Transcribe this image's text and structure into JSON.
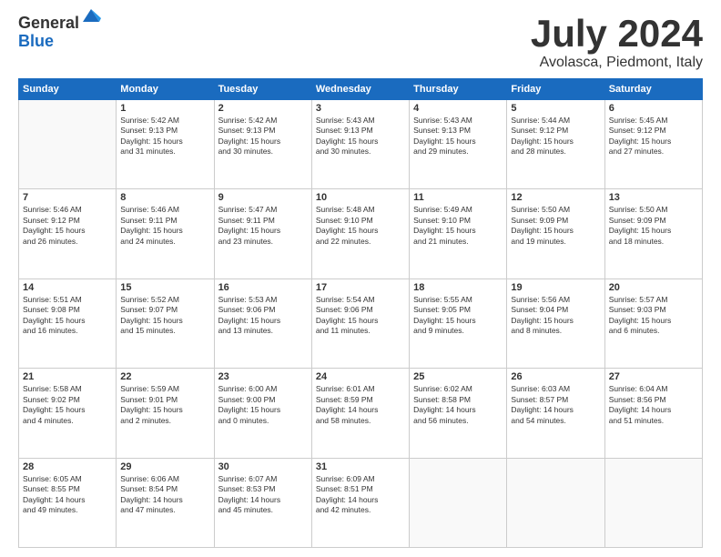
{
  "logo": {
    "general": "General",
    "blue": "Blue"
  },
  "title": "July 2024",
  "location": "Avolasca, Piedmont, Italy",
  "weekdays": [
    "Sunday",
    "Monday",
    "Tuesday",
    "Wednesday",
    "Thursday",
    "Friday",
    "Saturday"
  ],
  "weeks": [
    [
      {
        "day": "",
        "info": ""
      },
      {
        "day": "1",
        "info": "Sunrise: 5:42 AM\nSunset: 9:13 PM\nDaylight: 15 hours\nand 31 minutes."
      },
      {
        "day": "2",
        "info": "Sunrise: 5:42 AM\nSunset: 9:13 PM\nDaylight: 15 hours\nand 30 minutes."
      },
      {
        "day": "3",
        "info": "Sunrise: 5:43 AM\nSunset: 9:13 PM\nDaylight: 15 hours\nand 30 minutes."
      },
      {
        "day": "4",
        "info": "Sunrise: 5:43 AM\nSunset: 9:13 PM\nDaylight: 15 hours\nand 29 minutes."
      },
      {
        "day": "5",
        "info": "Sunrise: 5:44 AM\nSunset: 9:12 PM\nDaylight: 15 hours\nand 28 minutes."
      },
      {
        "day": "6",
        "info": "Sunrise: 5:45 AM\nSunset: 9:12 PM\nDaylight: 15 hours\nand 27 minutes."
      }
    ],
    [
      {
        "day": "7",
        "info": "Sunrise: 5:46 AM\nSunset: 9:12 PM\nDaylight: 15 hours\nand 26 minutes."
      },
      {
        "day": "8",
        "info": "Sunrise: 5:46 AM\nSunset: 9:11 PM\nDaylight: 15 hours\nand 24 minutes."
      },
      {
        "day": "9",
        "info": "Sunrise: 5:47 AM\nSunset: 9:11 PM\nDaylight: 15 hours\nand 23 minutes."
      },
      {
        "day": "10",
        "info": "Sunrise: 5:48 AM\nSunset: 9:10 PM\nDaylight: 15 hours\nand 22 minutes."
      },
      {
        "day": "11",
        "info": "Sunrise: 5:49 AM\nSunset: 9:10 PM\nDaylight: 15 hours\nand 21 minutes."
      },
      {
        "day": "12",
        "info": "Sunrise: 5:50 AM\nSunset: 9:09 PM\nDaylight: 15 hours\nand 19 minutes."
      },
      {
        "day": "13",
        "info": "Sunrise: 5:50 AM\nSunset: 9:09 PM\nDaylight: 15 hours\nand 18 minutes."
      }
    ],
    [
      {
        "day": "14",
        "info": "Sunrise: 5:51 AM\nSunset: 9:08 PM\nDaylight: 15 hours\nand 16 minutes."
      },
      {
        "day": "15",
        "info": "Sunrise: 5:52 AM\nSunset: 9:07 PM\nDaylight: 15 hours\nand 15 minutes."
      },
      {
        "day": "16",
        "info": "Sunrise: 5:53 AM\nSunset: 9:06 PM\nDaylight: 15 hours\nand 13 minutes."
      },
      {
        "day": "17",
        "info": "Sunrise: 5:54 AM\nSunset: 9:06 PM\nDaylight: 15 hours\nand 11 minutes."
      },
      {
        "day": "18",
        "info": "Sunrise: 5:55 AM\nSunset: 9:05 PM\nDaylight: 15 hours\nand 9 minutes."
      },
      {
        "day": "19",
        "info": "Sunrise: 5:56 AM\nSunset: 9:04 PM\nDaylight: 15 hours\nand 8 minutes."
      },
      {
        "day": "20",
        "info": "Sunrise: 5:57 AM\nSunset: 9:03 PM\nDaylight: 15 hours\nand 6 minutes."
      }
    ],
    [
      {
        "day": "21",
        "info": "Sunrise: 5:58 AM\nSunset: 9:02 PM\nDaylight: 15 hours\nand 4 minutes."
      },
      {
        "day": "22",
        "info": "Sunrise: 5:59 AM\nSunset: 9:01 PM\nDaylight: 15 hours\nand 2 minutes."
      },
      {
        "day": "23",
        "info": "Sunrise: 6:00 AM\nSunset: 9:00 PM\nDaylight: 15 hours\nand 0 minutes."
      },
      {
        "day": "24",
        "info": "Sunrise: 6:01 AM\nSunset: 8:59 PM\nDaylight: 14 hours\nand 58 minutes."
      },
      {
        "day": "25",
        "info": "Sunrise: 6:02 AM\nSunset: 8:58 PM\nDaylight: 14 hours\nand 56 minutes."
      },
      {
        "day": "26",
        "info": "Sunrise: 6:03 AM\nSunset: 8:57 PM\nDaylight: 14 hours\nand 54 minutes."
      },
      {
        "day": "27",
        "info": "Sunrise: 6:04 AM\nSunset: 8:56 PM\nDaylight: 14 hours\nand 51 minutes."
      }
    ],
    [
      {
        "day": "28",
        "info": "Sunrise: 6:05 AM\nSunset: 8:55 PM\nDaylight: 14 hours\nand 49 minutes."
      },
      {
        "day": "29",
        "info": "Sunrise: 6:06 AM\nSunset: 8:54 PM\nDaylight: 14 hours\nand 47 minutes."
      },
      {
        "day": "30",
        "info": "Sunrise: 6:07 AM\nSunset: 8:53 PM\nDaylight: 14 hours\nand 45 minutes."
      },
      {
        "day": "31",
        "info": "Sunrise: 6:09 AM\nSunset: 8:51 PM\nDaylight: 14 hours\nand 42 minutes."
      },
      {
        "day": "",
        "info": ""
      },
      {
        "day": "",
        "info": ""
      },
      {
        "day": "",
        "info": ""
      }
    ]
  ]
}
